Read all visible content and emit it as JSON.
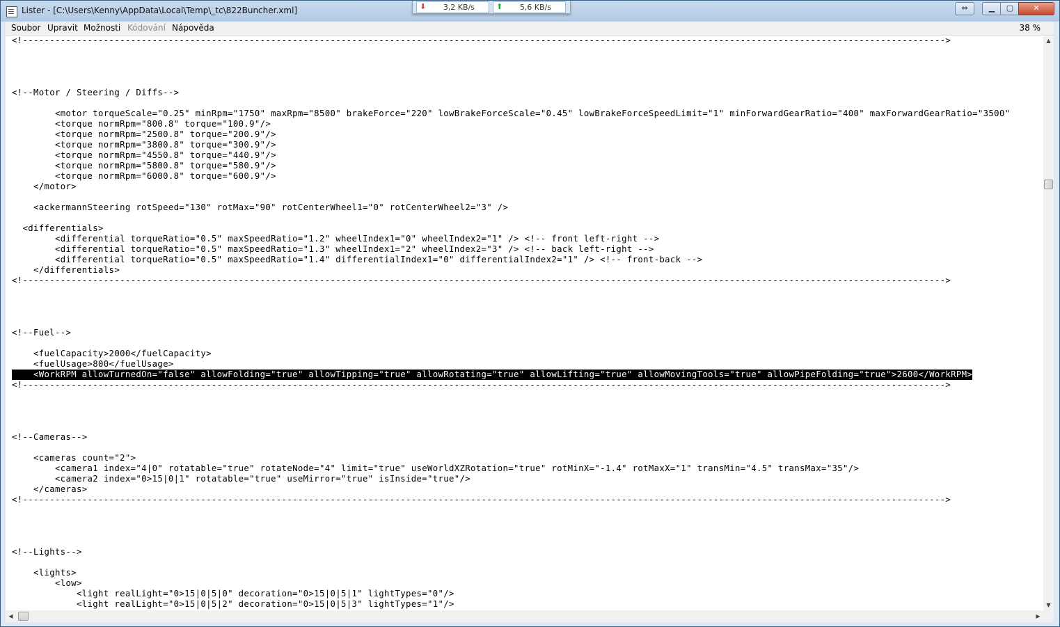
{
  "window": {
    "title": "Lister - [C:\\Users\\Kenny\\AppData\\Local\\Temp\\_tc\\822Buncher.xml]"
  },
  "netmeter": {
    "download": "3,2 KB/s",
    "upload": "5,6 KB/s"
  },
  "menu": {
    "items": [
      {
        "label": "Soubor",
        "disabled": false
      },
      {
        "label": "Upravit",
        "disabled": false
      },
      {
        "label": "Možnosti",
        "disabled": false
      },
      {
        "label": "Kódování",
        "disabled": true
      },
      {
        "label": "Nápověda",
        "disabled": false
      }
    ],
    "zoom": "38 %"
  },
  "document": {
    "lines": [
      "<!--------------------------------------------------------------------------------------------------------------------------------------------------------------------------->",
      "",
      "",
      "",
      "",
      "<!--Motor / Steering / Diffs-->",
      "",
      "        <motor torqueScale=\"0.25\" minRpm=\"1750\" maxRpm=\"8500\" brakeForce=\"220\" lowBrakeForceScale=\"0.45\" lowBrakeForceSpeedLimit=\"1\" minForwardGearRatio=\"400\" maxForwardGearRatio=\"3500\"",
      "        <torque normRpm=\"800.8\" torque=\"100.9\"/>",
      "        <torque normRpm=\"2500.8\" torque=\"200.9\"/>",
      "        <torque normRpm=\"3800.8\" torque=\"300.9\"/>",
      "        <torque normRpm=\"4550.8\" torque=\"440.9\"/>",
      "        <torque normRpm=\"5800.8\" torque=\"580.9\"/>",
      "        <torque normRpm=\"6000.8\" torque=\"600.9\"/>",
      "    </motor>",
      "",
      "    <ackermannSteering rotSpeed=\"130\" rotMax=\"90\" rotCenterWheel1=\"0\" rotCenterWheel2=\"3\" />",
      "",
      "  <differentials>",
      "        <differential torqueRatio=\"0.5\" maxSpeedRatio=\"1.2\" wheelIndex1=\"0\" wheelIndex2=\"1\" /> <!-- front left-right -->",
      "        <differential torqueRatio=\"0.5\" maxSpeedRatio=\"1.3\" wheelIndex1=\"2\" wheelIndex2=\"3\" /> <!-- back left-right -->",
      "        <differential torqueRatio=\"0.5\" maxSpeedRatio=\"1.4\" differentialIndex1=\"0\" differentialIndex2=\"1\" /> <!-- front-back -->",
      "    </differentials>",
      "<!--------------------------------------------------------------------------------------------------------------------------------------------------------------------------->",
      "",
      "",
      "",
      "",
      "<!--Fuel-->",
      "",
      "    <fuelCapacity>2000</fuelCapacity>",
      "    <fuelUsage>800</fuelUsage>",
      "    <WorkRPM allowTurnedOn=\"false\" allowFolding=\"true\" allowTipping=\"true\" allowRotating=\"true\" allowLifting=\"true\" allowMovingTools=\"true\" allowPipeFolding=\"true\">2600</WorkRPM>",
      "<!--------------------------------------------------------------------------------------------------------------------------------------------------------------------------->",
      "",
      "",
      "",
      "",
      "<!--Cameras-->",
      "",
      "    <cameras count=\"2\">",
      "        <camera1 index=\"4|0\" rotatable=\"true\" rotateNode=\"4\" limit=\"true\" useWorldXZRotation=\"true\" rotMinX=\"-1.4\" rotMaxX=\"1\" transMin=\"4.5\" transMax=\"35\"/>",
      "        <camera2 index=\"0>15|0|1\" rotatable=\"true\" useMirror=\"true\" isInside=\"true\"/>",
      "    </cameras>",
      "<!--------------------------------------------------------------------------------------------------------------------------------------------------------------------------->",
      "",
      "",
      "",
      "",
      "<!--Lights-->",
      "",
      "    <lights>",
      "        <low>",
      "            <light realLight=\"0>15|0|5|0\" decoration=\"0>15|0|5|1\" lightTypes=\"0\"/>",
      "            <light realLight=\"0>15|0|5|2\" decoration=\"0>15|0|5|3\" lightTypes=\"1\"/>"
    ],
    "highlighted_line": 32
  }
}
